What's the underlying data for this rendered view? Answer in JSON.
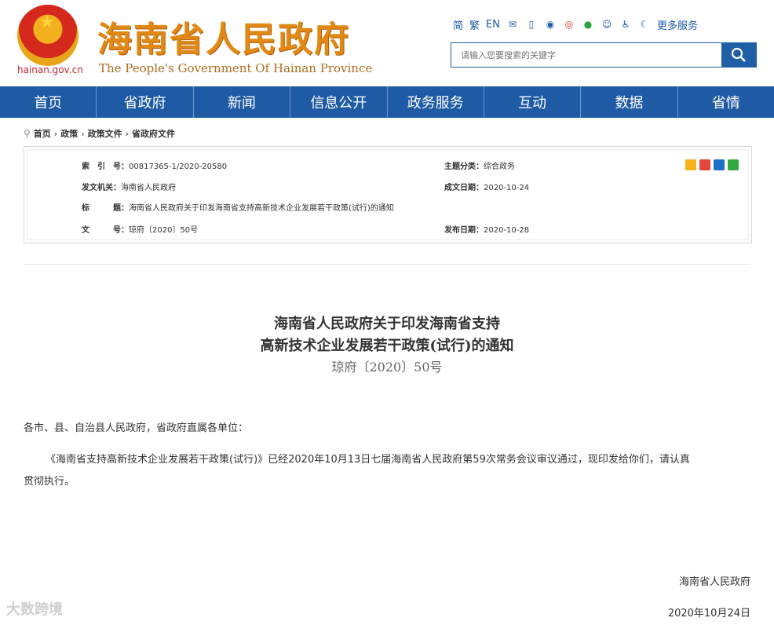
{
  "header": {
    "domain": "hainan.gov.cn",
    "title_cn": "海南省人民政府",
    "title_en": "The People's Government Of Hainan Province",
    "tools": [
      "简",
      "繁",
      "EN"
    ],
    "more_services": "更多服务",
    "search_placeholder": "请输入您要搜索的关键字",
    "icons": [
      "mail-icon",
      "mobile-icon",
      "robot-icon",
      "weibo-icon",
      "wechat-icon",
      "user-icon",
      "accessibility-icon",
      "elderly-icon"
    ]
  },
  "nav": [
    "首页",
    "省政府",
    "新闻",
    "信息公开",
    "政务服务",
    "互动",
    "数据",
    "省情"
  ],
  "breadcrumb": [
    "首页",
    "政策",
    "政策文件",
    "省政府文件"
  ],
  "meta": {
    "index_label": "索　引　号：",
    "index_value": "00817365-1/2020-20580",
    "topic_label": "主题分类：",
    "topic_value": "综合政务",
    "issuer_label": "发文机关：",
    "issuer_value": "海南省人民政府",
    "date_label": "成文日期：",
    "date_value": "2020-10-24",
    "title_label": "标　　　题：",
    "title_value": "海南省人民政府关于印发海南省支持高新技术企业发展若干政策(试行)的通知",
    "docno_label": "文　　　号：",
    "docno_value": "琼府〔2020〕50号",
    "pub_label": "发布日期：",
    "pub_value": "2020-10-28"
  },
  "document": {
    "title_line1": "海南省人民政府关于印发海南省支持",
    "title_line2": "高新技术企业发展若干政策(试行)的通知",
    "doc_number": "琼府〔2020〕50号",
    "recipients": "各市、县、自治县人民政府，省政府直属各单位：",
    "para1": "《海南省支持高新技术企业发展若干政策(试行)》已经2020年10月13日七届海南省人民政府第59次常务会议审议通过，现印发给你们，请认真",
    "para1_cont": "贯彻执行。",
    "signature": "海南省人民政府",
    "sign_date": "2020年10月24日"
  },
  "watermark": "大数跨境",
  "colors": {
    "nav": "#1f5aa4",
    "title": "#e08a15",
    "emblem": "#d4281d"
  }
}
